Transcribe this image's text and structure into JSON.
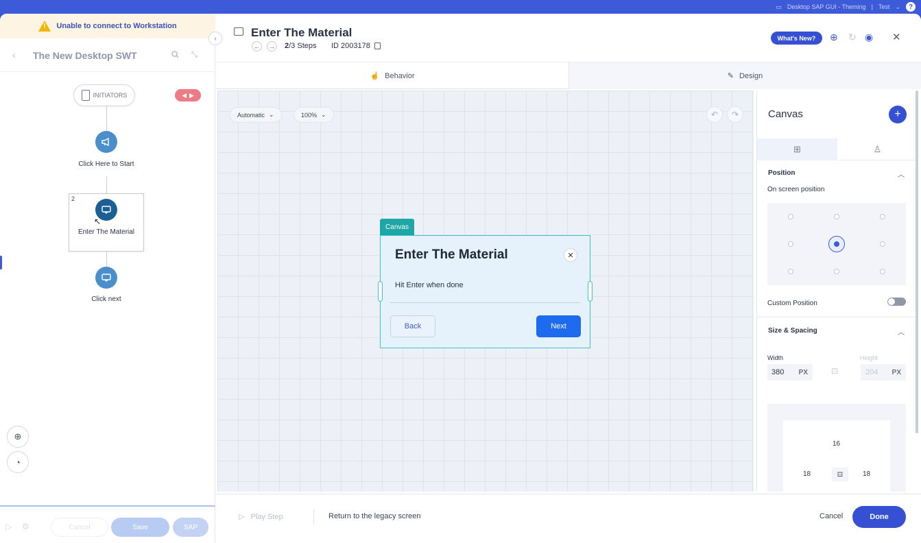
{
  "topbar": {
    "env": "Desktop SAP GUI - Theming",
    "sep": "|",
    "mode": "Test",
    "help": "?"
  },
  "warning": {
    "text": "Unable to connect to Workstation"
  },
  "left": {
    "title": "The New Desktop SWT",
    "initiators": "INITIATORS",
    "steps": [
      {
        "label": "Click Here to Start"
      },
      {
        "number": "2",
        "label": "Enter The Material"
      },
      {
        "label": "Click next"
      }
    ],
    "footer": {
      "cancel": "Cancel",
      "save": "Save",
      "sap": "SAP"
    }
  },
  "header": {
    "title": "Enter The Material",
    "step_current": "2",
    "step_total": "/3 Steps",
    "id": "ID 2003178",
    "whats_new": "What's New?"
  },
  "tabs": {
    "behavior": "Behavior",
    "design": "Design"
  },
  "canvas": {
    "mode": "Automatic",
    "zoom": "100%",
    "tag": "Canvas",
    "card": {
      "title": "Enter The Material",
      "body": "Hit Enter when done",
      "back": "Back",
      "next": "Next"
    }
  },
  "panel": {
    "title": "Canvas",
    "position_section": "Position",
    "on_screen_position": "On screen position",
    "custom_position": "Custom Position",
    "size_section": "Size & Spacing",
    "width_label": "Width",
    "width_value": "380",
    "width_unit": "PX",
    "height_label": "Height",
    "height_value": "204",
    "height_unit": "PX",
    "spacing_top": "16",
    "spacing_left": "18",
    "spacing_right": "18"
  },
  "footer": {
    "play_step": "Play Step",
    "legacy": "Return to the legacy screen",
    "cancel": "Cancel",
    "done": "Done"
  },
  "colors": {
    "accent": "#3550d3",
    "teal": "#1fa6a6",
    "next": "#1f6bf0",
    "warn": "#f5b400"
  }
}
